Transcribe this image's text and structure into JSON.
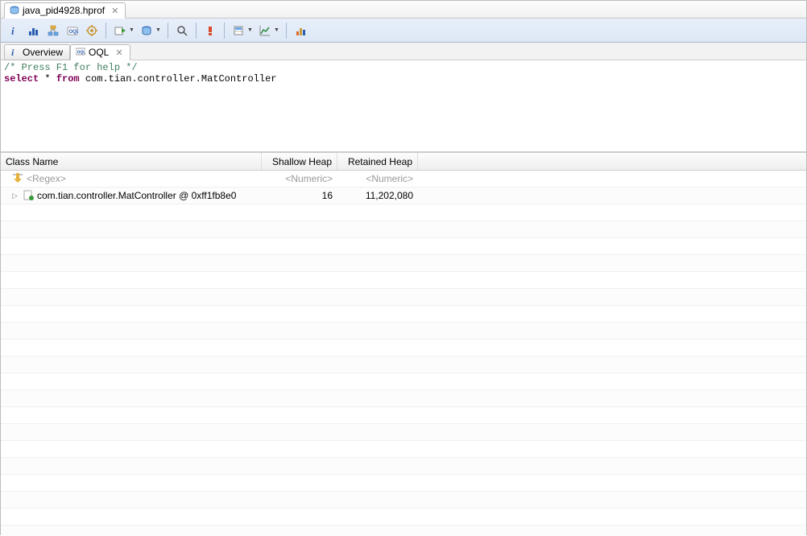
{
  "file_tab": {
    "title": "java_pid4928.hprof"
  },
  "toolbar": {
    "items": [
      {
        "name": "info-icon",
        "title": "Info"
      },
      {
        "name": "histogram-icon",
        "title": "Histogram"
      },
      {
        "name": "dominator-icon",
        "title": "Dominator Tree"
      },
      {
        "name": "oql-icon",
        "title": "OQL"
      },
      {
        "name": "gear-icon",
        "title": "Options"
      },
      {
        "sep": true
      },
      {
        "name": "run-query-icon",
        "title": "Run Query",
        "dropdown": true
      },
      {
        "name": "db-icon",
        "title": "Database",
        "dropdown": true
      },
      {
        "sep": true
      },
      {
        "name": "search-icon",
        "title": "Search"
      },
      {
        "sep": true
      },
      {
        "name": "exclaim-icon",
        "title": "Problem"
      },
      {
        "sep": true
      },
      {
        "name": "calc-icon",
        "title": "Calculate",
        "dropdown": true
      },
      {
        "name": "chart-icon",
        "title": "Chart",
        "dropdown": true
      },
      {
        "sep": true
      },
      {
        "name": "totals-icon",
        "title": "Totals"
      }
    ]
  },
  "subtabs": {
    "overview_label": "Overview",
    "oql_label": "OQL"
  },
  "editor": {
    "comment": "/* Press F1 for help */",
    "keyword_select": "select",
    "wildcard": " * ",
    "keyword_from": "from",
    "classname": " com.tian.controller.MatController"
  },
  "table": {
    "headers": {
      "class_name": "Class Name",
      "shallow": "Shallow Heap",
      "retained": "Retained Heap"
    },
    "filter_row": {
      "name_placeholder": "<Regex>",
      "shallow_placeholder": "<Numeric>",
      "retained_placeholder": "<Numeric>"
    },
    "rows": [
      {
        "name": "com.tian.controller.MatController @ 0xff1fb8e0",
        "shallow": "16",
        "retained": "11,202,080"
      }
    ]
  }
}
